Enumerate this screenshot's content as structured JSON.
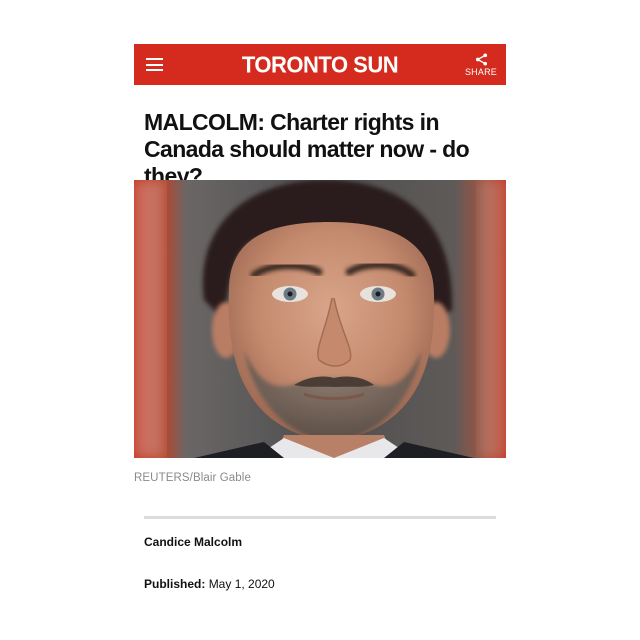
{
  "header": {
    "brand": "TORONTO SUN",
    "menu_icon": "hamburger-menu-icon",
    "share_icon": "share-icon",
    "share_label": "SHARE",
    "bar_color": "#d42b1e"
  },
  "article": {
    "headline": "MALCOLM: Charter rights in Canada should matter now - do they?",
    "photo_credit": "REUTERS/Blair Gable",
    "author": "Candice Malcolm",
    "published_label": "Published:",
    "published_date": "May 1, 2020"
  }
}
